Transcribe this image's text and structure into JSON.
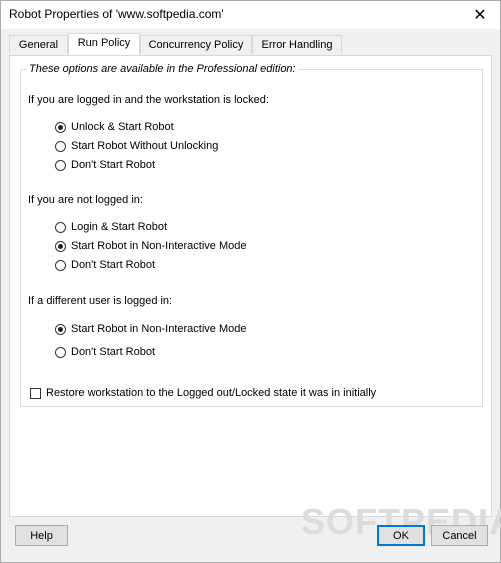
{
  "window": {
    "title": "Robot Properties of 'www.softpedia.com'"
  },
  "tabs": [
    {
      "label": "General"
    },
    {
      "label": "Run Policy"
    },
    {
      "label": "Concurrency Policy"
    },
    {
      "label": "Error Handling"
    }
  ],
  "active_tab": "Run Policy",
  "group": {
    "title": "These options are available in the Professional edition:",
    "locked": {
      "label": "If you are logged in and the workstation is locked:",
      "options": [
        "Unlock & Start Robot",
        "Start Robot Without Unlocking",
        "Don't Start Robot"
      ],
      "selected": "Unlock & Start Robot"
    },
    "not_logged": {
      "label": "If you are not logged in:",
      "options": [
        "Login & Start Robot",
        "Start Robot in Non-Interactive Mode",
        "Don't Start Robot"
      ],
      "selected": "Start Robot in Non-Interactive Mode"
    },
    "different_user": {
      "label": "If a different user is logged in:",
      "options": [
        "Start Robot in Non-Interactive Mode",
        "Don't Start Robot"
      ],
      "selected": "Start Robot in Non-Interactive Mode"
    },
    "restore_checkbox": {
      "label": "Restore workstation to the Logged out/Locked state it was in initially",
      "checked": false
    }
  },
  "buttons": {
    "help": "Help",
    "ok": "OK",
    "cancel": "Cancel"
  },
  "watermark": "SOFTPEDIA"
}
